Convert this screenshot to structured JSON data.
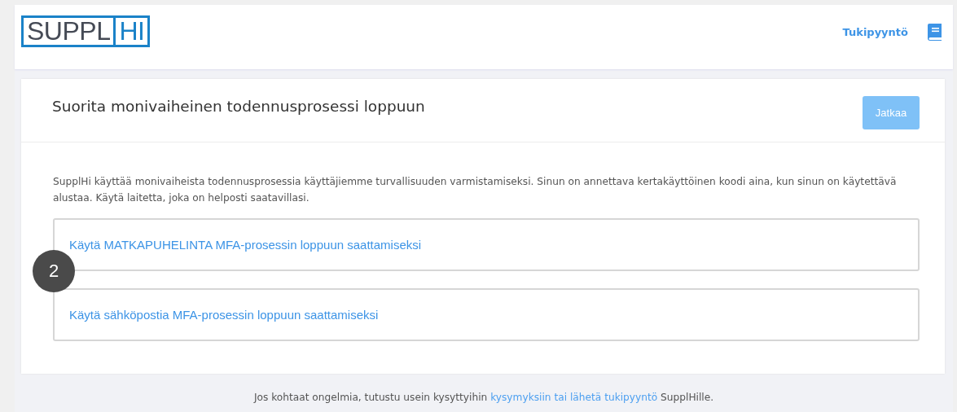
{
  "header": {
    "logo": [
      "SUPPL",
      "HI"
    ],
    "support_link": "Tukipyyntö"
  },
  "card": {
    "title": "Suorita monivaiheinen todennusprosessi loppuun",
    "continue_button": {
      "label": "Jatkaa",
      "disabled": true
    },
    "description": "SupplHi käyttää monivaiheista todennusprosessia käyttäjiemme turvallisuuden varmistamiseksi. Sinun on annettava kertakäyttöinen koodi aina, kun sinun on käytettävä alustaa. Käytä laitetta, joka on helposti saatavillasi.",
    "options": [
      {
        "label": "Käytä MATKAPUHELINTA MFA-prosessin loppuun saattamiseksi"
      },
      {
        "label": "Käytä sähköpostia MFA-prosessin loppuun saattamiseksi"
      }
    ]
  },
  "step_badge": "2",
  "footer": {
    "text_before": "Jos kohtaat ongelmia, tutustu usein kysyttyihin",
    "link": "kysymyksiin tai lähetä tukipyyntö",
    "text_after": "SupplHille."
  }
}
